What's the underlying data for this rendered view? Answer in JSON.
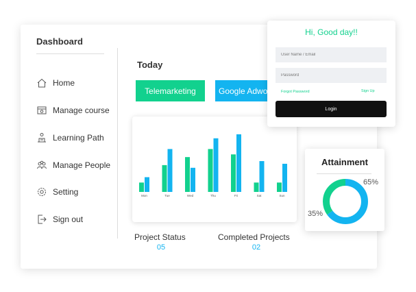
{
  "dashboard": {
    "title": "Dashboard"
  },
  "sidebar": {
    "items": [
      {
        "label": "Home",
        "icon": "home-icon"
      },
      {
        "label": "Manage course",
        "icon": "course-icon"
      },
      {
        "label": "Learning Path",
        "icon": "learning-path-icon"
      },
      {
        "label": "Manage People",
        "icon": "people-icon"
      },
      {
        "label": "Setting",
        "icon": "gear-icon"
      },
      {
        "label": "Sign out",
        "icon": "sign-out-icon"
      }
    ]
  },
  "main": {
    "today_label": "Today",
    "tabs": [
      {
        "label": "Telemarketing",
        "color": "#12d18e"
      },
      {
        "label": "Google Adwords",
        "color": "#13b4f0"
      }
    ],
    "stats": [
      {
        "label": "Project Status",
        "value": "05"
      },
      {
        "label": "Completed Projects",
        "value": "02"
      }
    ]
  },
  "chart_data": {
    "type": "bar",
    "categories": [
      "Mon",
      "Tue",
      "Wed",
      "Thu",
      "Fri",
      "Sat",
      "Sun"
    ],
    "series": [
      {
        "values": [
          14,
          40,
          52,
          64,
          56,
          14,
          14
        ],
        "color": "#12d18e"
      },
      {
        "values": [
          22,
          64,
          36,
          80,
          86,
          46,
          42
        ],
        "color": "#13b4f0"
      }
    ],
    "ylim": [
      0,
      90
    ],
    "grid": false
  },
  "login": {
    "greeting": "Hi, Good day!!",
    "username_placeholder": "User Name / Email",
    "password_placeholder": "Password",
    "forgot_label": "Forgot Password",
    "signup_label": "Sign Up",
    "login_label": "Login"
  },
  "attainment": {
    "title": "Attainment",
    "values": [
      {
        "label": "65%",
        "value": 65,
        "color": "#13b4f0"
      },
      {
        "label": "35%",
        "value": 35,
        "color": "#12d18e"
      }
    ]
  },
  "colors": {
    "accent_green": "#12d18e",
    "accent_blue": "#13b4f0"
  }
}
